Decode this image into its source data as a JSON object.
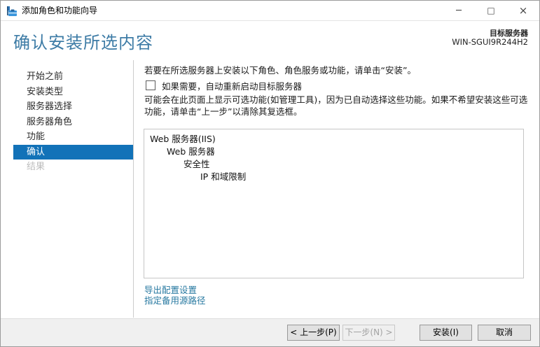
{
  "window": {
    "title": "添加角色和功能向导",
    "controls": {
      "minimize": "─",
      "maximize": "□",
      "close": "×"
    }
  },
  "header": {
    "page_title": "确认安装所选内容",
    "target_server_label": "目标服务器",
    "target_server_name": "WIN-SGUI9R244H2"
  },
  "sidebar": {
    "items": [
      {
        "label": "开始之前",
        "state": "normal"
      },
      {
        "label": "安装类型",
        "state": "normal"
      },
      {
        "label": "服务器选择",
        "state": "normal"
      },
      {
        "label": "服务器角色",
        "state": "normal"
      },
      {
        "label": "功能",
        "state": "normal"
      },
      {
        "label": "确认",
        "state": "selected"
      },
      {
        "label": "结果",
        "state": "disabled"
      }
    ]
  },
  "main": {
    "intro": "若要在所选服务器上安装以下角色、角色服务或功能，请单击“安装”。",
    "restart_checkbox": {
      "label": "如果需要，自动重新启动目标服务器",
      "checked": false
    },
    "note": "可能会在此页面上显示可选功能(如管理工具)，因为已自动选择这些功能。如果不希望安装这些可选功能，请单击“上一步”以清除其复选框。",
    "selection_tree": [
      {
        "label": "Web 服务器(IIS)",
        "level": 0
      },
      {
        "label": "Web 服务器",
        "level": 1
      },
      {
        "label": "安全性",
        "level": 2
      },
      {
        "label": "IP 和域限制",
        "level": 3
      }
    ],
    "links": [
      {
        "label": "导出配置设置"
      },
      {
        "label": "指定备用源路径"
      }
    ]
  },
  "footer": {
    "buttons": [
      {
        "label": "< 上一步(P)",
        "enabled": true
      },
      {
        "label": "下一步(N) >",
        "enabled": false
      },
      {
        "label": "安装(I)",
        "enabled": true
      },
      {
        "label": "取消",
        "enabled": true
      }
    ]
  },
  "colors": {
    "accent_selected": "#1272b8",
    "heading": "#3e7ca6",
    "link": "#2678a0"
  }
}
